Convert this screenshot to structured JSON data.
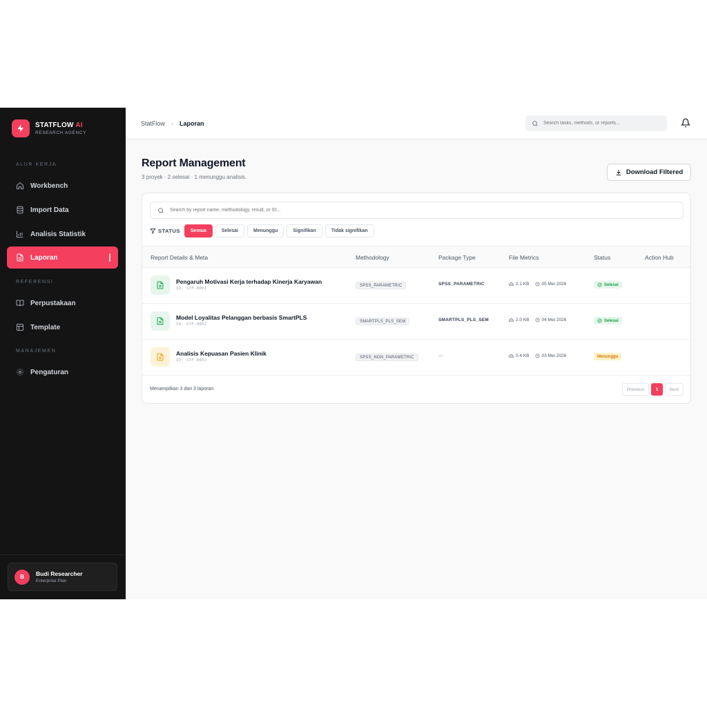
{
  "brand": {
    "name_main": "STATFLOW",
    "name_accent": "AI",
    "subtitle": "RESEARCH AGENCY"
  },
  "sidebar": {
    "sections": [
      {
        "label": "ALUR KERJA"
      },
      {
        "label": "REFERENSI"
      },
      {
        "label": "MANAJEMEN"
      }
    ],
    "items": [
      {
        "label": "Workbench",
        "icon": "home-icon"
      },
      {
        "label": "Import Data",
        "icon": "database-icon"
      },
      {
        "label": "Analisis Statistik",
        "icon": "bar-chart-icon"
      },
      {
        "label": "Laporan",
        "icon": "file-text-icon",
        "active": true
      },
      {
        "label": "Perpustakaan",
        "icon": "book-open-icon"
      },
      {
        "label": "Template",
        "icon": "layout-icon"
      },
      {
        "label": "Pengaturan",
        "icon": "gear-icon"
      }
    ],
    "user": {
      "initial": "B",
      "name": "Budi Researcher",
      "plan": "Enterprise Plan"
    }
  },
  "topbar": {
    "breadcrumb": {
      "root": "StatFlow",
      "current": "Laporan"
    },
    "search_placeholder": "Search tasks, methods, or reports..."
  },
  "page": {
    "title": "Report Management",
    "subtitle": "3 proyek · 2 selesai · 1 menunggu analisis.",
    "download_label": "Download Filtered"
  },
  "filters": {
    "search_placeholder": "Search by report name, methodology, result, or ID...",
    "status_label": "STATUS",
    "chips": [
      "Semua",
      "Selesai",
      "Menunggu",
      "Signifikan",
      "Tidak signifikan"
    ],
    "active_chip": "Semua"
  },
  "table": {
    "headers": [
      "Report Details & Meta",
      "Methodology",
      "Package Type",
      "File Metrics",
      "Status",
      "Action Hub"
    ],
    "rows": [
      {
        "title": "Pengaruh Motivasi Kerja terhadap Kinerja Karyawan",
        "id": "ID: STF-0001",
        "methodology": "SPSS_PARAMETRIC",
        "package": "SPSS_PARAMETRIC",
        "size": "2.1 KB",
        "date": "05 Mei 2026",
        "status": "Selesai",
        "state": "ok"
      },
      {
        "title": "Model Loyalitas Pelanggan berbasis SmartPLS",
        "id": "ID: STF-0002",
        "methodology": "SMARTPLS_PLS_SEM",
        "package": "SMARTPLS_PLS_SEM",
        "size": "2.0 KB",
        "date": "04 Mei 2026",
        "status": "Selesai",
        "state": "ok"
      },
      {
        "title": "Analisis Kepuasan Pasien Klinik",
        "id": "ID: STF-0003",
        "methodology": "SPSS_NON_PARAMETRIC",
        "package": "—",
        "size": "0.4 KB",
        "date": "03 Mei 2026",
        "status": "Menunggu",
        "state": "wait"
      }
    ],
    "footer_text": "Menampilkan 3 dari 3 laporan",
    "pager": {
      "previous": "Previous",
      "current": "1",
      "next": "Next"
    }
  },
  "colors": {
    "accent": "#f43f5e",
    "sidebar_bg": "#141414",
    "success": "#16a34a",
    "warning": "#d97706"
  }
}
